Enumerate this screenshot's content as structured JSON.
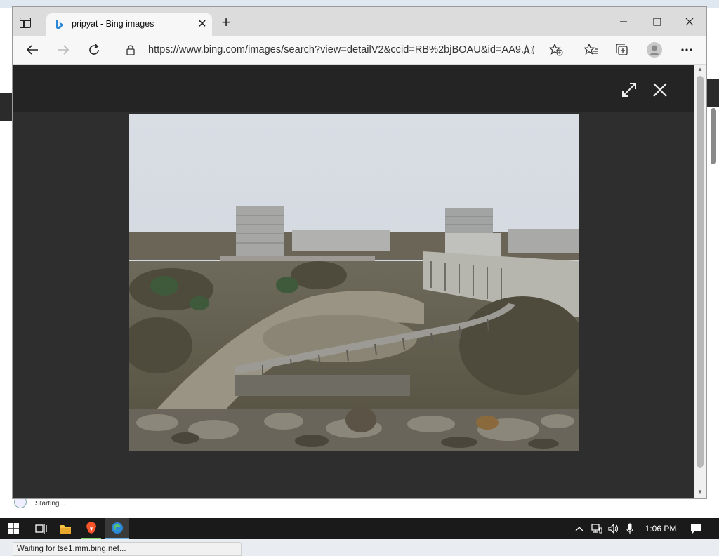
{
  "browser": {
    "tab_title": "pripyat - Bing images",
    "url": "https://www.bing.com/images/search?view=detailV2&ccid=RB%2bjBOAU&id=AA9...",
    "status_text": "Waiting for tse1.mm.bing.net..."
  },
  "desktop": {
    "starting_text": "Starting..."
  },
  "taskbar": {
    "time": "1:06 PM"
  },
  "colors": {
    "viewer_bg": "#2e2e2e",
    "overlay_bg": "#242424",
    "taskbar_bg": "#1a1a1a",
    "edge_accent": "#2b88d8",
    "brave_accent": "#fb542b"
  },
  "icons": {
    "tab_actions": "tab-actions-icon",
    "bing_favicon": "bing-icon",
    "back": "back-arrow-icon",
    "forward": "forward-arrow-icon",
    "refresh": "refresh-icon",
    "lock": "lock-icon",
    "read_aloud": "read-aloud-icon",
    "add_favorite": "favorite-add-icon",
    "favorites": "favorites-icon",
    "collections": "collections-icon",
    "profile": "profile-icon",
    "menu": "more-icon",
    "expand": "expand-icon",
    "close_viewer": "close-icon"
  }
}
